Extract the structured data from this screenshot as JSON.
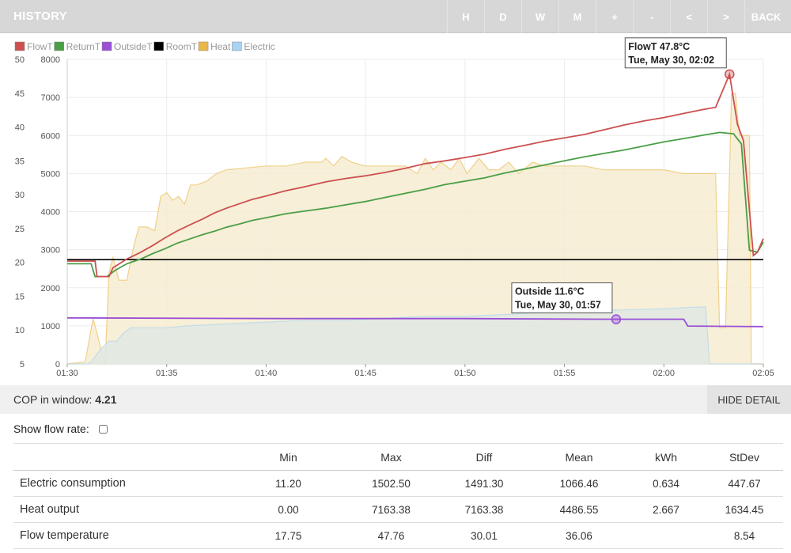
{
  "header": {
    "title": "HISTORY",
    "buttons": [
      "H",
      "D",
      "W",
      "M",
      "+",
      "-",
      "<",
      ">",
      "BACK"
    ]
  },
  "chart_data": {
    "type": "line",
    "legend": [
      {
        "name": "FlowT",
        "color": "#cc5050"
      },
      {
        "name": "ReturnT",
        "color": "#4a9e45"
      },
      {
        "name": "OutsideT",
        "color": "#9a4fd6"
      },
      {
        "name": "RoomT",
        "color": "#000000"
      },
      {
        "name": "Heat",
        "color": "#e9b84a"
      },
      {
        "name": "Electric",
        "color": "#a9d3f2"
      }
    ],
    "legend_position": "top-left",
    "y_left": {
      "range": [
        5,
        50
      ],
      "ticks": [
        "50",
        "45",
        "40",
        "35",
        "30",
        "25",
        "20",
        "15",
        "10",
        "5"
      ]
    },
    "y_right": {
      "range": [
        0,
        8000
      ],
      "ticks": [
        "8000",
        "7000",
        "6000",
        "5000",
        "4000",
        "3000",
        "2000",
        "1000",
        "0"
      ]
    },
    "x_ticks": [
      "01:30",
      "01:35",
      "01:40",
      "01:45",
      "01:50",
      "01:55",
      "02:00",
      "02:05"
    ],
    "x_range_minutes": [
      0,
      35
    ],
    "grid": true,
    "series": [
      {
        "name": "FlowT",
        "axis": "left",
        "color": "#cc5050",
        "points": [
          [
            0,
            20.2
          ],
          [
            1.4,
            20.2
          ],
          [
            1.5,
            17.9
          ],
          [
            2.1,
            17.9
          ],
          [
            2.3,
            19.2
          ],
          [
            3,
            20.5
          ],
          [
            3.7,
            21.5
          ],
          [
            4.3,
            22.5
          ],
          [
            4.9,
            23.6
          ],
          [
            5.5,
            24.6
          ],
          [
            6.2,
            25.6
          ],
          [
            6.8,
            26.4
          ],
          [
            7.4,
            27.3
          ],
          [
            8,
            28.0
          ],
          [
            8.7,
            28.7
          ],
          [
            9.3,
            29.3
          ],
          [
            10,
            29.8
          ],
          [
            11,
            30.6
          ],
          [
            12,
            31.2
          ],
          [
            13,
            31.9
          ],
          [
            14,
            32.4
          ],
          [
            15,
            32.8
          ],
          [
            16,
            33.3
          ],
          [
            17,
            33.9
          ],
          [
            18,
            34.6
          ],
          [
            19,
            35.0
          ],
          [
            20,
            35.5
          ],
          [
            21,
            36.0
          ],
          [
            22,
            36.7
          ],
          [
            23,
            37.3
          ],
          [
            24,
            37.9
          ],
          [
            25,
            38.4
          ],
          [
            26,
            38.9
          ],
          [
            27,
            39.6
          ],
          [
            28,
            40.3
          ],
          [
            29,
            40.9
          ],
          [
            30,
            41.4
          ],
          [
            31,
            42.0
          ],
          [
            32,
            42.6
          ],
          [
            32.6,
            42.9
          ],
          [
            33.3,
            47.8
          ],
          [
            33.7,
            40.4
          ],
          [
            34.0,
            38.0
          ],
          [
            34.5,
            21.0
          ],
          [
            34.7,
            21.5
          ],
          [
            35,
            23.5
          ]
        ]
      },
      {
        "name": "ReturnT",
        "axis": "left",
        "color": "#4a9e45",
        "points": [
          [
            0,
            19.8
          ],
          [
            1.2,
            19.8
          ],
          [
            1.4,
            17.9
          ],
          [
            2.0,
            17.9
          ],
          [
            2.4,
            18.8
          ],
          [
            3,
            19.8
          ],
          [
            3.7,
            20.5
          ],
          [
            4.3,
            21.3
          ],
          [
            4.9,
            22.0
          ],
          [
            5.5,
            22.8
          ],
          [
            6.2,
            23.5
          ],
          [
            6.8,
            24.1
          ],
          [
            7.4,
            24.6
          ],
          [
            8,
            25.2
          ],
          [
            8.7,
            25.7
          ],
          [
            9.3,
            26.2
          ],
          [
            10,
            26.6
          ],
          [
            11,
            27.2
          ],
          [
            12,
            27.6
          ],
          [
            13,
            28.0
          ],
          [
            14,
            28.5
          ],
          [
            15,
            29.0
          ],
          [
            16,
            29.6
          ],
          [
            17,
            30.2
          ],
          [
            18,
            30.8
          ],
          [
            19,
            31.5
          ],
          [
            20,
            32.0
          ],
          [
            21,
            32.5
          ],
          [
            22,
            33.2
          ],
          [
            23,
            33.8
          ],
          [
            24,
            34.4
          ],
          [
            25,
            35.0
          ],
          [
            26,
            35.6
          ],
          [
            27,
            36.1
          ],
          [
            28,
            36.6
          ],
          [
            29,
            37.2
          ],
          [
            30,
            37.8
          ],
          [
            31,
            38.3
          ],
          [
            32,
            38.8
          ],
          [
            32.8,
            39.2
          ],
          [
            33.5,
            39.0
          ],
          [
            33.9,
            37.5
          ],
          [
            34.3,
            21.8
          ],
          [
            34.7,
            21.5
          ],
          [
            35,
            23.0
          ]
        ]
      },
      {
        "name": "OutsideT",
        "axis": "left",
        "color": "#9a4fd6",
        "points": [
          [
            0,
            11.8
          ],
          [
            11,
            11.7
          ],
          [
            20,
            11.7
          ],
          [
            27,
            11.6
          ],
          [
            31,
            11.6
          ],
          [
            31.2,
            10.6
          ],
          [
            35,
            10.5
          ]
        ]
      },
      {
        "name": "RoomT",
        "axis": "left",
        "color": "#000000",
        "points": [
          [
            0,
            20.4
          ],
          [
            35,
            20.4
          ]
        ]
      },
      {
        "name": "Heat",
        "axis": "right",
        "color": "#e9b84a",
        "fill": "#f6ecd1",
        "points": [
          [
            0,
            0
          ],
          [
            0.9,
            50
          ],
          [
            1.3,
            1200
          ],
          [
            1.5,
            800
          ],
          [
            1.9,
            0
          ],
          [
            2.1,
            2400
          ],
          [
            2.3,
            2800
          ],
          [
            2.6,
            2200
          ],
          [
            3.0,
            2200
          ],
          [
            3.3,
            3000
          ],
          [
            3.6,
            3600
          ],
          [
            4.0,
            3600
          ],
          [
            4.4,
            3500
          ],
          [
            4.7,
            4400
          ],
          [
            5.0,
            4500
          ],
          [
            5.3,
            4300
          ],
          [
            5.6,
            4400
          ],
          [
            5.9,
            4200
          ],
          [
            6.2,
            4700
          ],
          [
            6.5,
            4700
          ],
          [
            7.0,
            4800
          ],
          [
            7.5,
            5000
          ],
          [
            8,
            5100
          ],
          [
            9,
            5150
          ],
          [
            10,
            5200
          ],
          [
            11,
            5200
          ],
          [
            12,
            5300
          ],
          [
            12.8,
            5300
          ],
          [
            13,
            5400
          ],
          [
            13.4,
            5200
          ],
          [
            13.8,
            5450
          ],
          [
            14.3,
            5300
          ],
          [
            15,
            5200
          ],
          [
            16,
            5200
          ],
          [
            17,
            5200
          ],
          [
            17.6,
            5000
          ],
          [
            18,
            5400
          ],
          [
            18.4,
            5100
          ],
          [
            18.8,
            5300
          ],
          [
            19.3,
            5100
          ],
          [
            19.7,
            5400
          ],
          [
            20.1,
            5000
          ],
          [
            20.7,
            5400
          ],
          [
            21.2,
            5100
          ],
          [
            21.7,
            5100
          ],
          [
            22.2,
            5300
          ],
          [
            22.7,
            5000
          ],
          [
            23.4,
            5300
          ],
          [
            24,
            5200
          ],
          [
            25,
            5200
          ],
          [
            26,
            5200
          ],
          [
            27,
            5100
          ],
          [
            28,
            5100
          ],
          [
            29,
            5100
          ],
          [
            30,
            5100
          ],
          [
            31,
            5000
          ],
          [
            32,
            5000
          ],
          [
            32.6,
            5000
          ],
          [
            32.8,
            950
          ],
          [
            33.1,
            950
          ],
          [
            33.4,
            7100
          ],
          [
            33.6,
            7100
          ],
          [
            33.8,
            6000
          ],
          [
            34.3,
            6000
          ],
          [
            34.4,
            0
          ],
          [
            35,
            0
          ]
        ]
      },
      {
        "name": "Electric",
        "axis": "right",
        "color": "#a9d3f2",
        "fill": "#e1e8e3",
        "points": [
          [
            0,
            0
          ],
          [
            1.0,
            0
          ],
          [
            1.2,
            50
          ],
          [
            1.7,
            400
          ],
          [
            2.1,
            600
          ],
          [
            2.5,
            600
          ],
          [
            2.8,
            800
          ],
          [
            3.2,
            950
          ],
          [
            4.0,
            950
          ],
          [
            5,
            950
          ],
          [
            6,
            1000
          ],
          [
            8,
            1050
          ],
          [
            10,
            1100
          ],
          [
            12,
            1150
          ],
          [
            14,
            1150
          ],
          [
            16,
            1200
          ],
          [
            18,
            1250
          ],
          [
            20,
            1250
          ],
          [
            22,
            1300
          ],
          [
            24,
            1350
          ],
          [
            26,
            1400
          ],
          [
            28,
            1420
          ],
          [
            30,
            1450
          ],
          [
            31,
            1480
          ],
          [
            32.1,
            1500
          ],
          [
            32.3,
            0
          ],
          [
            32.8,
            0
          ],
          [
            33.5,
            0
          ],
          [
            35,
            0
          ]
        ]
      }
    ],
    "tooltips": [
      {
        "series": "FlowT",
        "x": 33.3,
        "y": 47.8,
        "line1": "FlowT 47.8°C",
        "line2": "Tue, May 30, 02:02"
      },
      {
        "series": "OutsideT",
        "x": 27.6,
        "y": 11.6,
        "line1": "Outside 11.6°C",
        "line2": "Tue, May 30, 01:57"
      }
    ]
  },
  "cop": {
    "label": "COP in window:",
    "value": "4.21"
  },
  "hide_detail_label": "HIDE DETAIL",
  "flow_rate_label": "Show flow rate:",
  "stats": {
    "headers": [
      "",
      "Min",
      "Max",
      "Diff",
      "Mean",
      "kWh",
      "StDev"
    ],
    "rows": [
      {
        "label": "Electric consumption",
        "min": "11.20",
        "max": "1502.50",
        "diff": "1491.30",
        "mean": "1066.46",
        "kwh": "0.634",
        "stdev": "447.67"
      },
      {
        "label": "Heat output",
        "min": "0.00",
        "max": "7163.38",
        "diff": "7163.38",
        "mean": "4486.55",
        "kwh": "2.667",
        "stdev": "1634.45"
      },
      {
        "label": "Flow temperature",
        "min": "17.75",
        "max": "47.76",
        "diff": "30.01",
        "mean": "36.06",
        "kwh": "",
        "stdev": "8.54"
      }
    ]
  }
}
